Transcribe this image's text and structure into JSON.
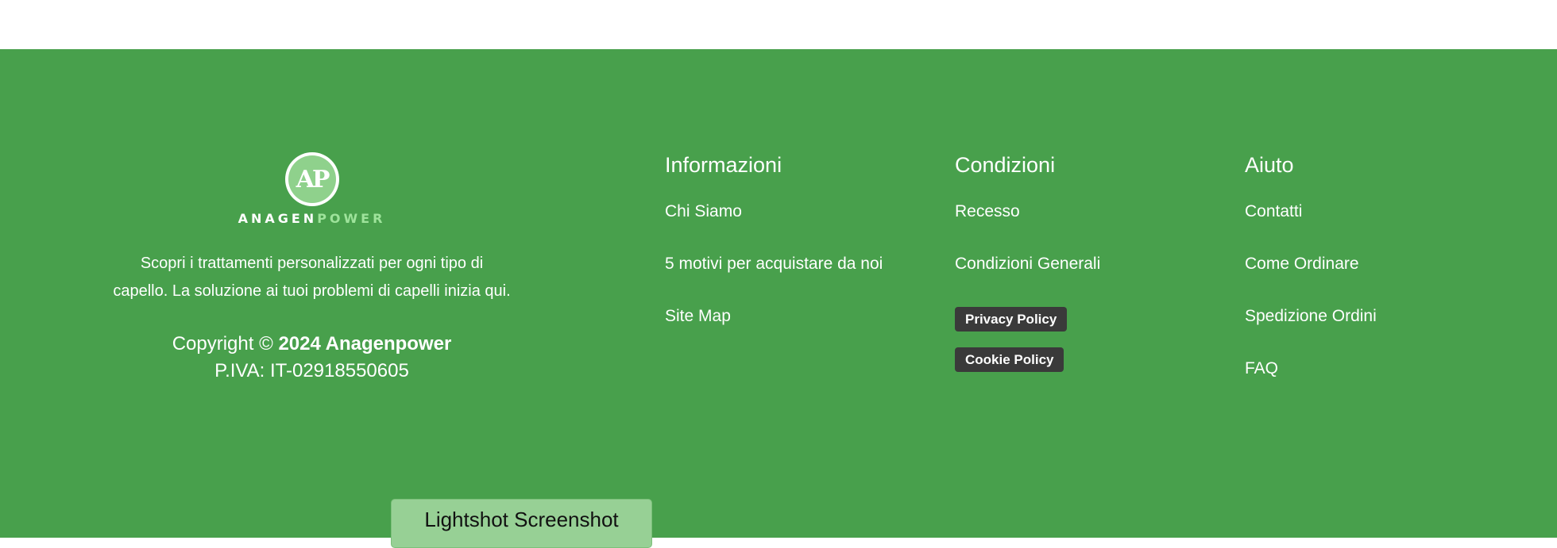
{
  "brand": {
    "logo_mark_text": "AP",
    "logo_word_1": "ANAGEN",
    "logo_word_2": "POWER",
    "description_line1": "Scopri i trattamenti personalizzati per ogni tipo di",
    "description_line2": "capello. La soluzione ai tuoi problemi di capelli inizia qui.",
    "copyright_prefix": "Copyright © ",
    "copyright_bold": "2024 Anagenpower",
    "vat": "P.IVA: IT-02918550605"
  },
  "columns": {
    "info": {
      "title": "Informazioni",
      "links": [
        "Chi Siamo",
        "5 motivi per acquistare da noi",
        "Site Map"
      ]
    },
    "conditions": {
      "title": "Condizioni",
      "links": [
        "Recesso",
        "Condizioni Generali"
      ],
      "badges": [
        "Privacy Policy",
        "Cookie Policy"
      ]
    },
    "help": {
      "title": "Aiuto",
      "links": [
        "Contatti",
        "Come Ordinare",
        "Spedizione Ordini",
        "FAQ"
      ]
    }
  },
  "overlay": {
    "lightshot_label": "Lightshot Screenshot"
  },
  "colors": {
    "footer_bg": "#48a04c",
    "badge_bg": "#3a3a3a",
    "logo_accent": "#9ee39b"
  }
}
